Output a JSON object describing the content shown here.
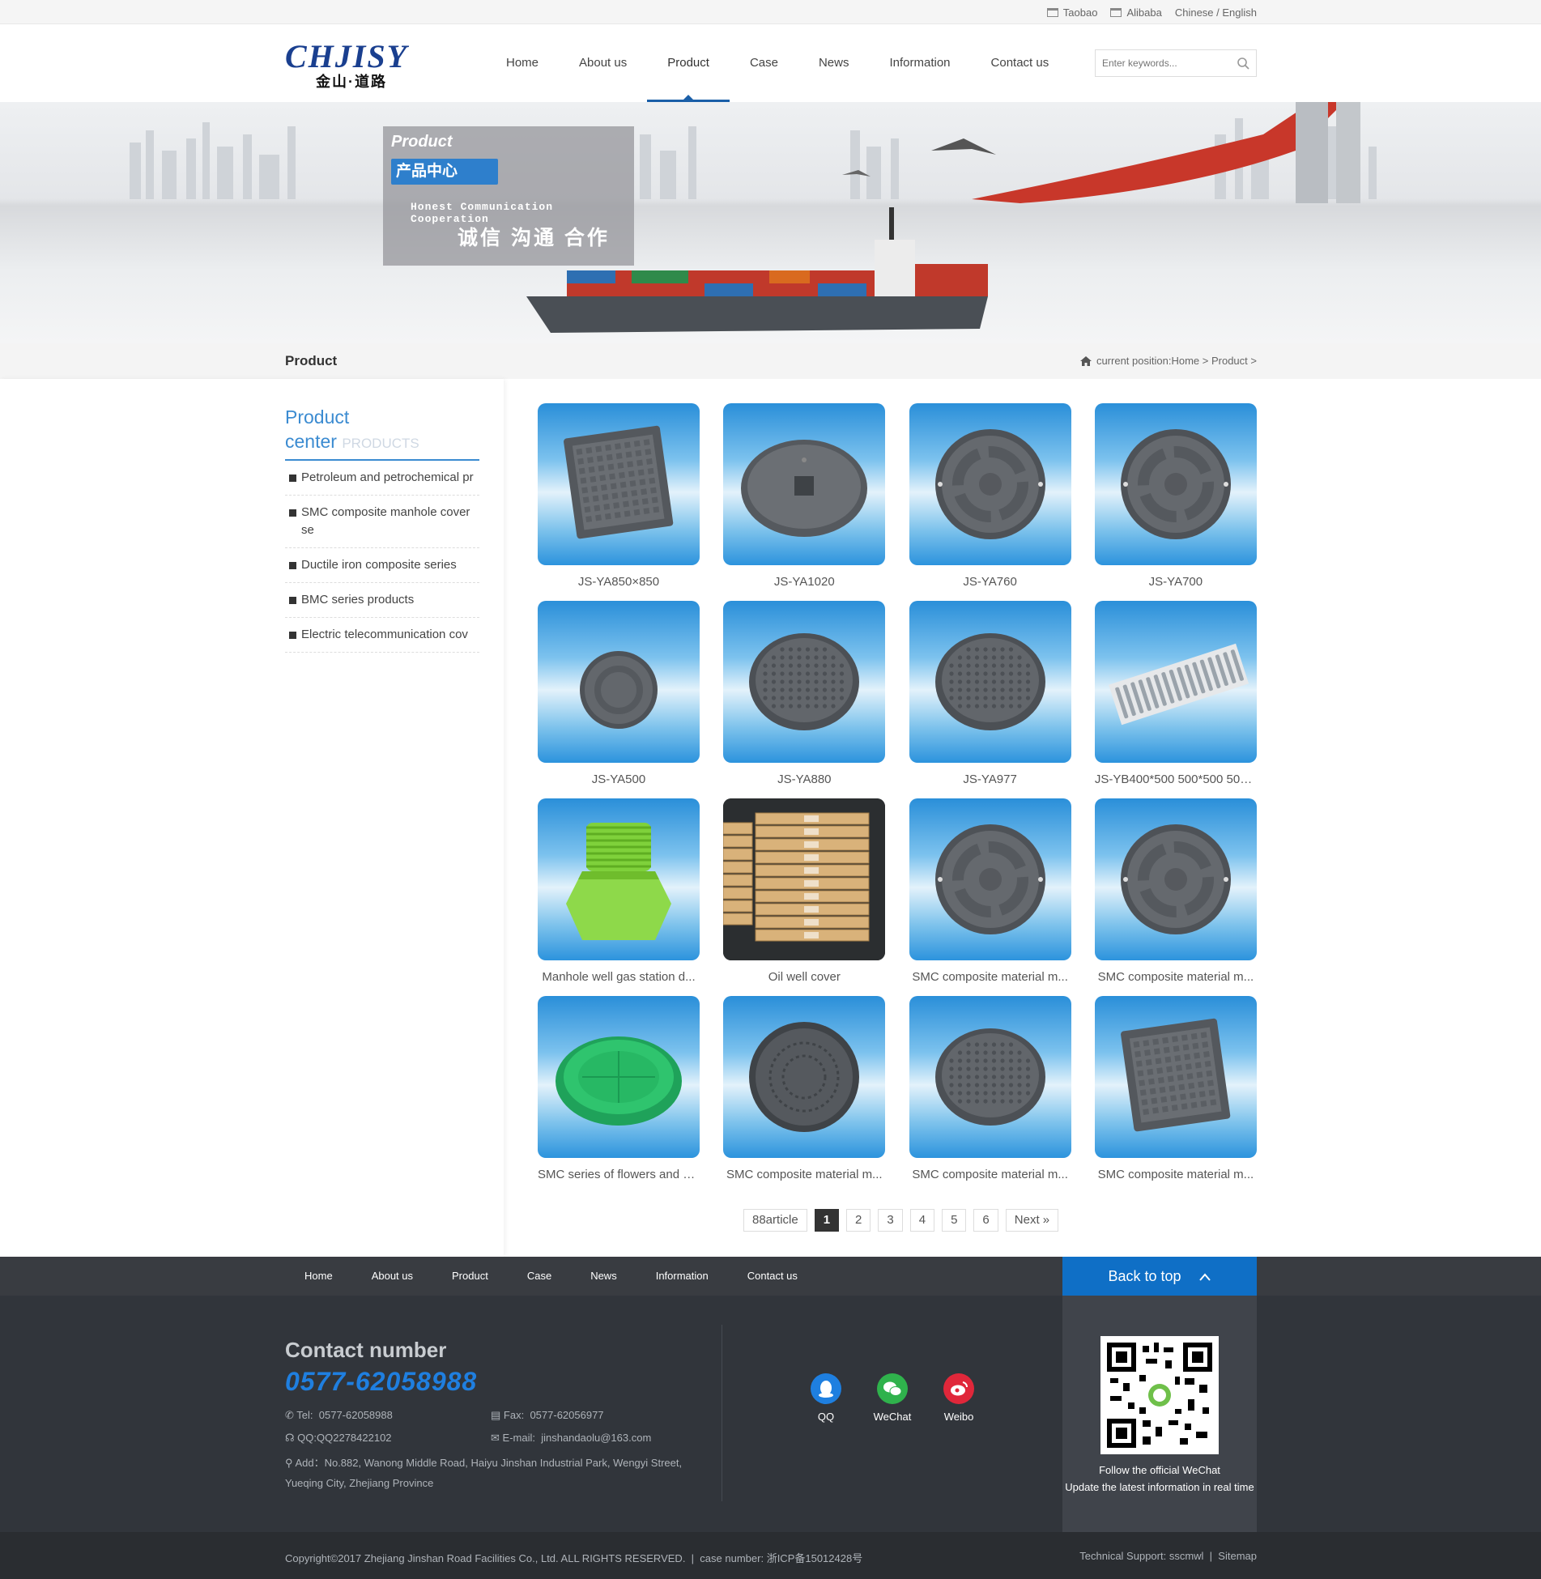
{
  "topbar": {
    "taobao": "Taobao",
    "alibaba": "Alibaba",
    "language": "Chinese / English"
  },
  "logo": {
    "en": "CHJISY",
    "cn": "金山·道路"
  },
  "nav": [
    "Home",
    "About us",
    "Product",
    "Case",
    "News",
    "Information",
    "Contact us"
  ],
  "search": {
    "placeholder": "Enter keywords..."
  },
  "banner": {
    "label": "Product",
    "cn_title": "产品中心",
    "slogan_en": "Honest Communication Cooperation",
    "slogan_cn": "诚信 沟通 合作"
  },
  "crumb": {
    "title": "Product",
    "position_label": "current position:",
    "home": "Home",
    "sep1": " > ",
    "current": "Product",
    "sep2": " >"
  },
  "sidebar": {
    "title_main": "Product",
    "title_main2": "center",
    "title_sub": "PRODUCTS",
    "items": [
      "Petroleum and petrochemical pr",
      "SMC composite manhole cover se",
      "Ductile iron composite series",
      "BMC series products",
      "Electric telecommunication cov"
    ]
  },
  "products": [
    {
      "name": "JS-YA850×850",
      "shape": "square"
    },
    {
      "name": "JS-YA1020",
      "shape": "round-ellipse"
    },
    {
      "name": "JS-YA760",
      "shape": "round"
    },
    {
      "name": "JS-YA700",
      "shape": "round"
    },
    {
      "name": "JS-YA500",
      "shape": "round-small"
    },
    {
      "name": "JS-YA880",
      "shape": "round-dots"
    },
    {
      "name": "JS-YA977",
      "shape": "round-dots"
    },
    {
      "name": "JS-YB400*500 500*500 500*...",
      "shape": "grate"
    },
    {
      "name": "Manhole well gas station d...",
      "shape": "green-well"
    },
    {
      "name": "Oil well cover",
      "shape": "pallets"
    },
    {
      "name": "SMC composite material m...",
      "shape": "round"
    },
    {
      "name": "SMC composite material m...",
      "shape": "round"
    },
    {
      "name": "SMC series of flowers and p...",
      "shape": "green-dish"
    },
    {
      "name": "SMC composite material m...",
      "shape": "round-pattern"
    },
    {
      "name": "SMC composite material m...",
      "shape": "round-dots"
    },
    {
      "name": "SMC composite material m...",
      "shape": "square"
    }
  ],
  "pager": {
    "total": "88article",
    "pages": [
      "1",
      "2",
      "3",
      "4",
      "5",
      "6"
    ],
    "current": "1",
    "next": "Next »"
  },
  "footer_nav": [
    "Home",
    "About us",
    "Product",
    "Case",
    "News",
    "Information",
    "Contact us"
  ],
  "back_to_top": "Back to top",
  "contact": {
    "title": "Contact number",
    "phone_big": "0577-62058988",
    "tel_label": "Tel:",
    "tel": "0577-62058988",
    "fax_label": "Fax:",
    "fax": "0577-62056977",
    "qq_label": "QQ:",
    "qq": "QQ2278422102",
    "email_label": "E-mail:",
    "email": "jinshandaolu@163.com",
    "addr_label": "Add：",
    "addr_line1": "No.882, Wanong Middle Road, Haiyu Jinshan Industrial Park, Wengyi Street,",
    "addr_line2": "Yueqing City, Zhejiang Province"
  },
  "social": [
    {
      "name": "QQ",
      "color": "#1e7fe0"
    },
    {
      "name": "WeChat",
      "color": "#2fb24c"
    },
    {
      "name": "Weibo",
      "color": "#e0273a"
    }
  ],
  "qr": {
    "line1": "Follow the official WeChat",
    "line2": "Update the latest information in real time"
  },
  "copyright": {
    "text": "Copyright©2017 Zhejiang Jinshan Road Facilities Co., Ltd. ALL RIGHTS RESERVED.",
    "sep": "|",
    "case_label": "case number:",
    "case_no": "浙ICP备15012428号",
    "support_label": "Technical Support:",
    "support": "sscmwl",
    "sitemap": "Sitemap"
  },
  "colors": {
    "accent": "#1a5fa8",
    "side_title": "#3b8bd1",
    "back_top": "#0f6fc6",
    "footer_bg": "#31353b",
    "phone": "#1f7fe0"
  }
}
